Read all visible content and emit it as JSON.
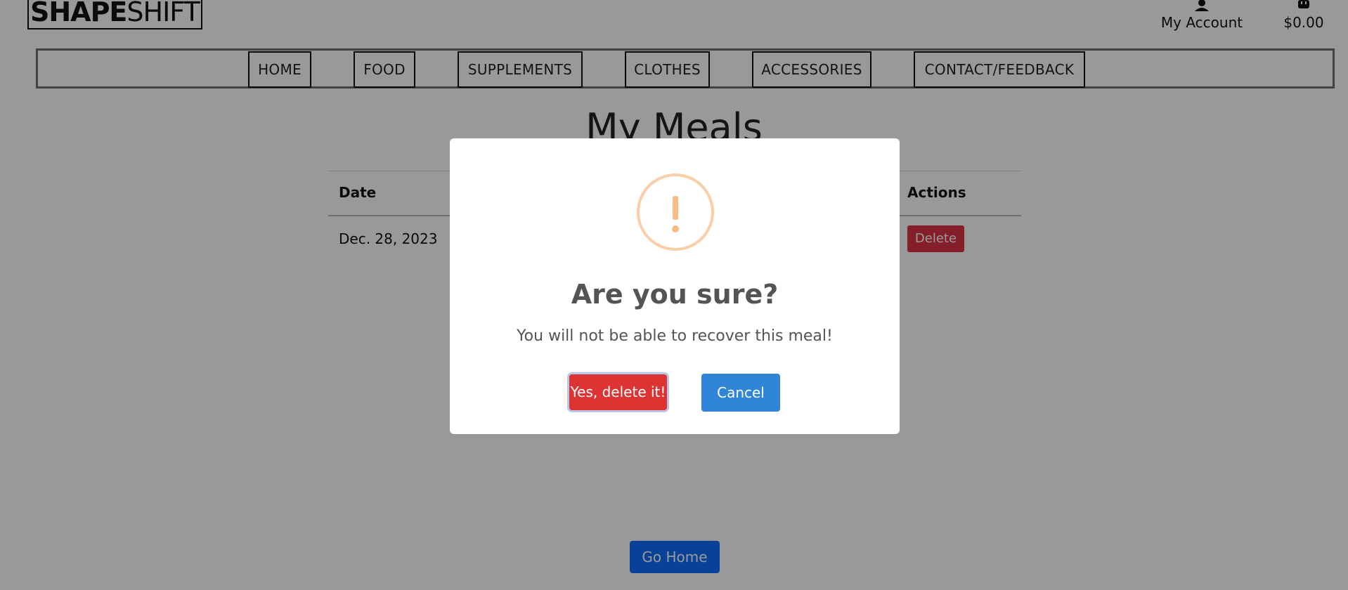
{
  "header": {
    "logo_bold": "SHAPE",
    "logo_light": "SHIFT",
    "account_label": "My Account",
    "bag_total": "$0.00"
  },
  "nav": {
    "items": [
      "HOME",
      "FOOD",
      "SUPPLEMENTS",
      "CLOTHES",
      "ACCESSORIES",
      "CONTACT/FEEDBACK"
    ]
  },
  "main": {
    "title": "My Meals",
    "table": {
      "headers": {
        "date": "Date",
        "actions": "Actions"
      },
      "rows": [
        {
          "date": "Dec. 28, 2023",
          "action": "Delete"
        }
      ]
    },
    "go_home_label": "Go Home"
  },
  "dialog": {
    "icon": "warning-icon",
    "title": "Are you sure?",
    "text": "You will not be able to recover this meal!",
    "confirm_label": "Yes, delete it!",
    "cancel_label": "Cancel"
  },
  "colors": {
    "overlay": "#00000066",
    "confirm": "#dd3333",
    "cancel": "#3085d6",
    "warning": "#f8bb86",
    "delete": "#dc3545",
    "primary": "#0d6efd"
  }
}
